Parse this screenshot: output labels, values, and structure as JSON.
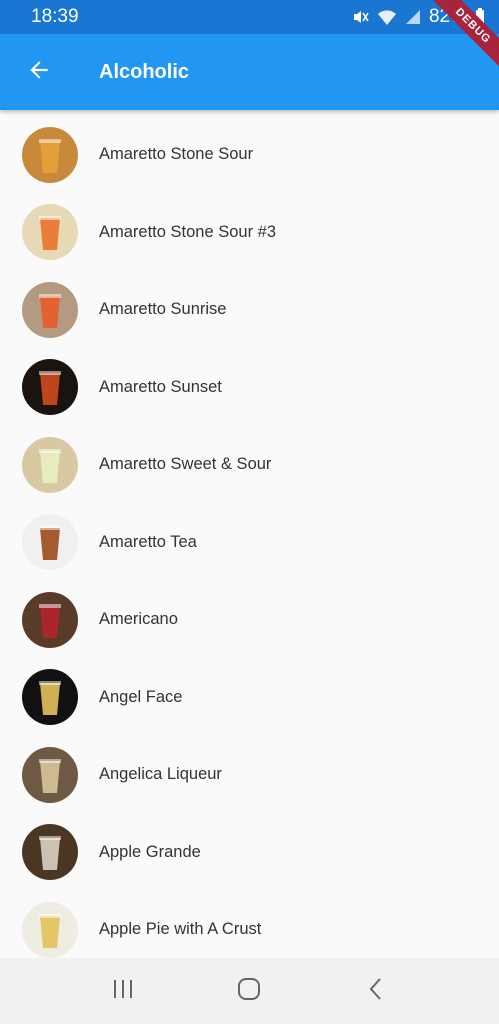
{
  "status_bar": {
    "time": "18:39",
    "battery": "82%",
    "icons": [
      "mute-icon",
      "wifi-icon",
      "signal-icon",
      "battery-icon"
    ]
  },
  "debug_banner": "DEBUG",
  "app_bar": {
    "title": "Alcoholic",
    "back_icon": "arrow-back-icon",
    "color": "#2196f3"
  },
  "drinks": [
    {
      "name": "Amaretto Stone Sour",
      "thumb_bg": "#c9893a",
      "accent": "#e8a23a"
    },
    {
      "name": "Amaretto Stone Sour #3",
      "thumb_bg": "#e7d8b6",
      "accent": "#e8742a"
    },
    {
      "name": "Amaretto Sunrise",
      "thumb_bg": "#b59a82",
      "accent": "#e85b2a"
    },
    {
      "name": "Amaretto Sunset",
      "thumb_bg": "#1a1410",
      "accent": "#d24a1e"
    },
    {
      "name": "Amaretto Sweet & Sour",
      "thumb_bg": "#d9c9a2",
      "accent": "#e9eec0"
    },
    {
      "name": "Amaretto Tea",
      "thumb_bg": "#f2f0ee",
      "accent": "#9a4a1a"
    },
    {
      "name": "Americano",
      "thumb_bg": "#5a3a28",
      "accent": "#b4242a"
    },
    {
      "name": "Angel Face",
      "thumb_bg": "#111111",
      "accent": "#e5c25a"
    },
    {
      "name": "Angelica Liqueur",
      "thumb_bg": "#6e5a44",
      "accent": "#d8c49a"
    },
    {
      "name": "Apple Grande",
      "thumb_bg": "#4a3622",
      "accent": "#d9d2c2"
    },
    {
      "name": "Apple Pie with A Crust",
      "thumb_bg": "#efece2",
      "accent": "#e2c25a"
    }
  ],
  "nav_bar": {
    "recents_icon": "recents-icon",
    "home_icon": "home-icon",
    "back_icon": "back-chevron-icon"
  }
}
